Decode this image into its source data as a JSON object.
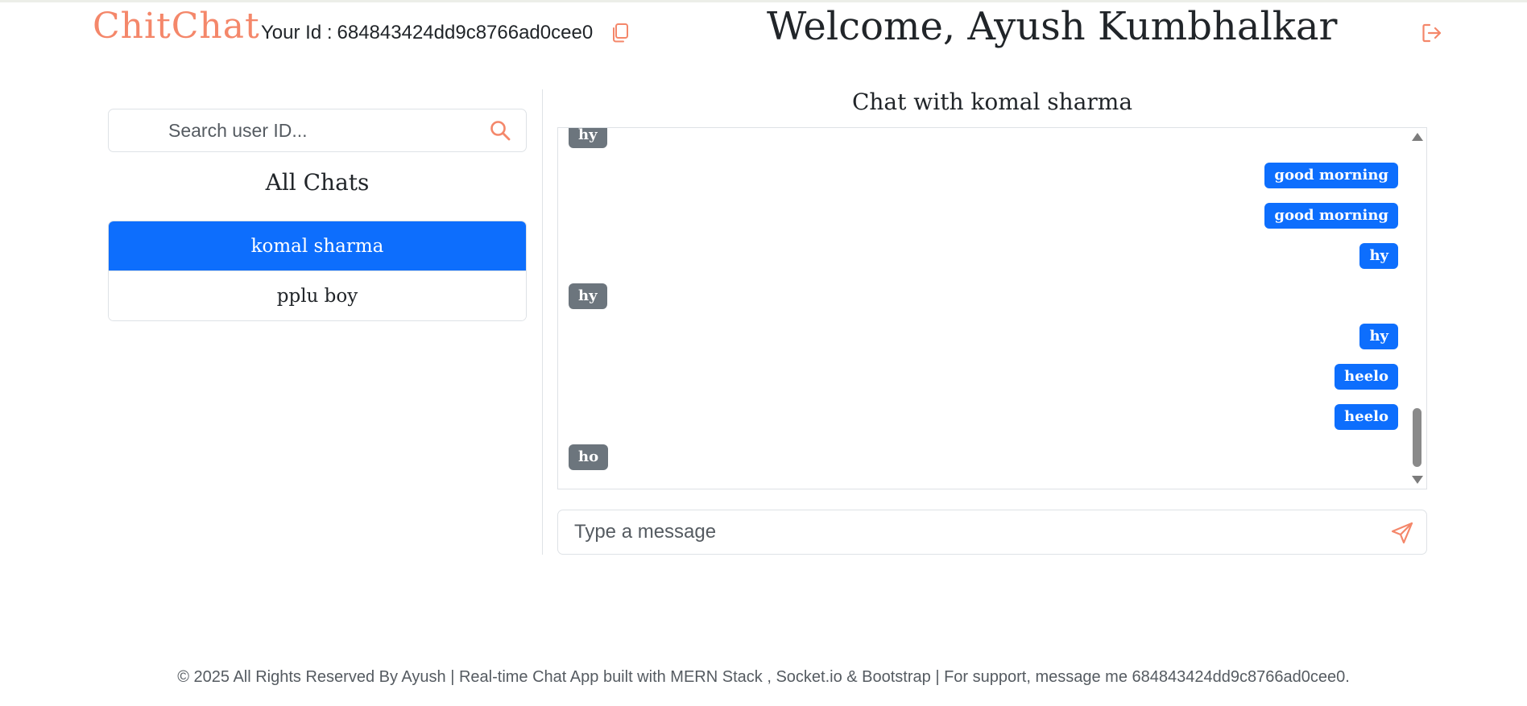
{
  "header": {
    "brand": "ChitChat",
    "id_label": "Your Id :",
    "user_id": "684843424dd9c8766ad0cee0",
    "welcome": "Welcome, Ayush Kumbhalkar",
    "copy_icon": "copy-icon",
    "logout_icon": "logout-icon"
  },
  "sidebar": {
    "search_placeholder": "Search user ID...",
    "search_value": "",
    "all_chats_title": "All Chats",
    "chats": [
      {
        "name": "komal sharma",
        "active": true
      },
      {
        "name": "pplu boy",
        "active": false
      }
    ]
  },
  "chat": {
    "title": "Chat with komal sharma",
    "messages": [
      {
        "text": "hy",
        "type": "received"
      },
      {
        "text": "good morning",
        "type": "sent"
      },
      {
        "text": "good morning",
        "type": "sent"
      },
      {
        "text": "hy",
        "type": "sent"
      },
      {
        "text": "hy",
        "type": "received"
      },
      {
        "text": "hy",
        "type": "sent"
      },
      {
        "text": "heelo",
        "type": "sent"
      },
      {
        "text": "heelo",
        "type": "sent"
      },
      {
        "text": "ho",
        "type": "received"
      }
    ],
    "input_placeholder": "Type a message",
    "input_value": "",
    "send_icon": "send-icon"
  },
  "footer": {
    "text": "© 2025 All Rights Reserved By Ayush | Real-time Chat App built with MERN Stack , Socket.io & Bootstrap | For support, message me 684843424dd9c8766ad0cee0."
  },
  "colors": {
    "brand": "#f4876a",
    "primary": "#0d6efd",
    "received_bubble": "#6c757d",
    "accent_icon": "#f4876a"
  }
}
